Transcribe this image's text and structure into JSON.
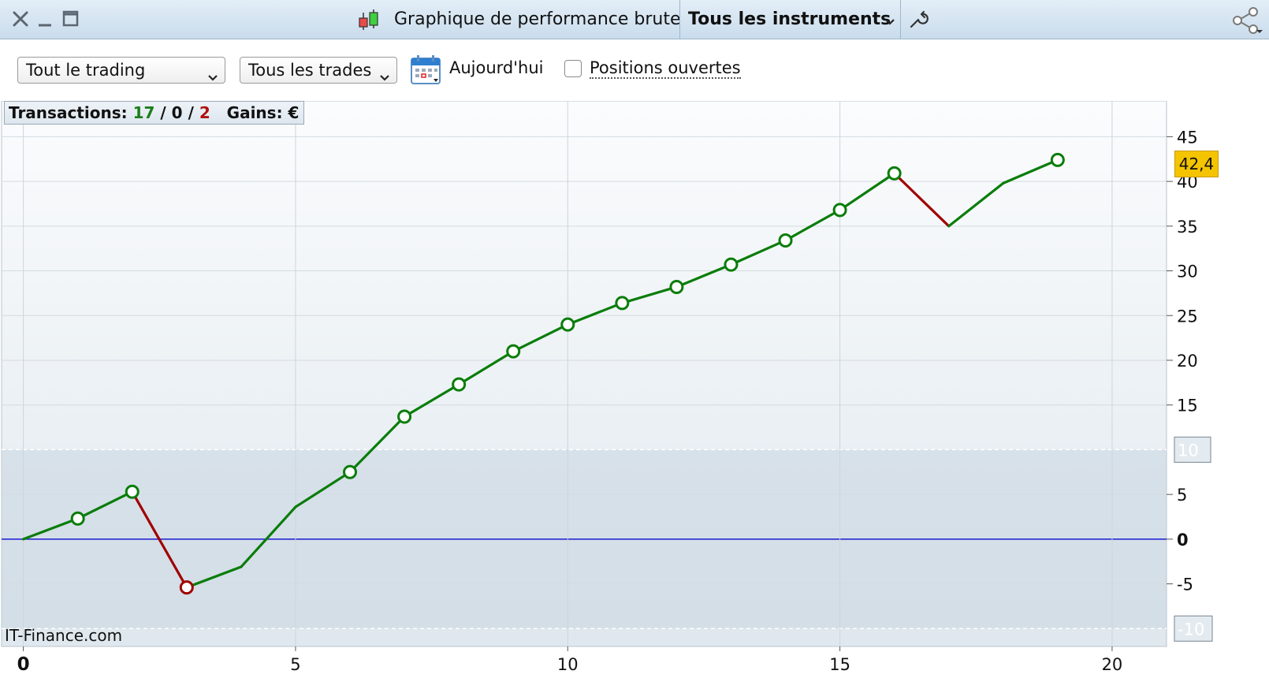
{
  "window": {
    "title": "Graphique de performance brute",
    "instrument_selector": "Tous les instruments"
  },
  "toolbar": {
    "period_select": "Tout le trading",
    "trades_select": "Tous les trades",
    "date_label": "Aujourd'hui",
    "open_positions_label": "Positions ouvertes",
    "open_positions_checked": false
  },
  "stats": {
    "transactions_label": "Transactions:",
    "wins": "17",
    "sep1": "/",
    "neutral": "0",
    "sep2": "/",
    "losses": "2",
    "gains_label": "Gains:",
    "currency": "€"
  },
  "current_value_badge": "42,4",
  "watermark": "IT-Finance.com",
  "colors": {
    "win": "#0a7d0a",
    "loss": "#a00000",
    "zero_line": "#1a1ad0",
    "badge": "#f5c400"
  },
  "chart_data": {
    "type": "line",
    "x": [
      0,
      1,
      2,
      3,
      4,
      5,
      6,
      7,
      8,
      9,
      10,
      11,
      12,
      13,
      14,
      15,
      16,
      17,
      18,
      19
    ],
    "y": [
      0,
      2.3,
      5.3,
      -5.4,
      -3.1,
      3.6,
      7.5,
      13.7,
      17.3,
      21.0,
      24.0,
      26.4,
      28.2,
      30.7,
      33.4,
      36.8,
      40.9,
      35.0,
      39.8,
      42.4
    ],
    "markers": [
      false,
      true,
      true,
      true,
      false,
      false,
      true,
      true,
      true,
      true,
      true,
      true,
      true,
      true,
      true,
      true,
      true,
      false,
      false,
      true
    ],
    "segment_result": [
      "win",
      "win",
      "loss",
      "win",
      "win",
      "win",
      "win",
      "win",
      "win",
      "win",
      "win",
      "win",
      "win",
      "win",
      "win",
      "win",
      "loss",
      "win",
      "win"
    ],
    "xlim": [
      -0.4,
      21
    ],
    "ylim": [
      -12,
      49
    ],
    "xticks": [
      0,
      5,
      10,
      15,
      20
    ],
    "xtick_labels": [
      "0",
      "5",
      "10",
      "15",
      "20"
    ],
    "yticks": [
      45,
      40,
      35,
      30,
      25,
      20,
      15,
      5,
      0,
      -5
    ],
    "ytick_labels": [
      "45",
      "40",
      "35",
      "30",
      "25",
      "20",
      "15",
      "5",
      "0",
      "-5"
    ],
    "boxed_ticks": [
      10,
      -10
    ],
    "boxed_tick_labels": [
      "10",
      "-10"
    ],
    "band": [
      -10,
      10
    ],
    "grid": true
  }
}
